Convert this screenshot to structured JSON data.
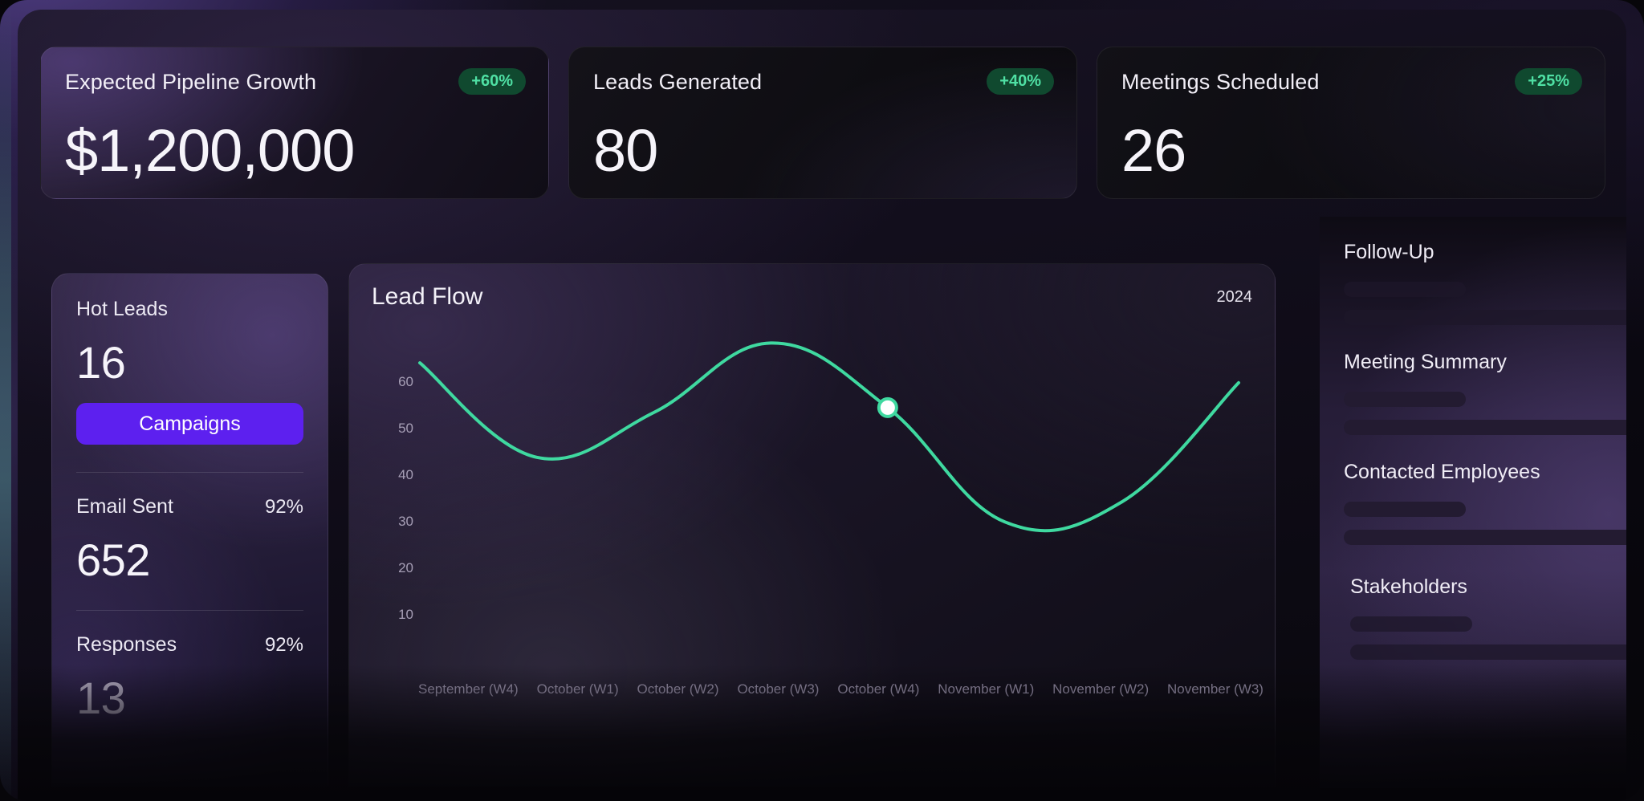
{
  "kpis": [
    {
      "title": "Expected Pipeline Growth",
      "value": "$1,200,000",
      "badge": "+60%"
    },
    {
      "title": "Leads Generated",
      "value": "80",
      "badge": "+40%"
    },
    {
      "title": "Meetings Scheduled",
      "value": "26",
      "badge": "+25%"
    }
  ],
  "left_card": {
    "hot_leads_label": "Hot Leads",
    "hot_leads_value": "16",
    "campaigns_button": "Campaigns",
    "email_sent_label": "Email Sent",
    "email_sent_pct": "92%",
    "email_sent_value": "652",
    "responses_label": "Responses",
    "responses_pct": "92%",
    "responses_value": "13"
  },
  "chart_data": {
    "type": "line",
    "title": "Lead Flow",
    "year_label": "2024",
    "xlabel": "",
    "ylabel": "",
    "grid": false,
    "legend": "none",
    "line_color": "#3fd9a0",
    "ylim": [
      5,
      68
    ],
    "yticks": [
      60,
      50,
      40,
      30,
      20,
      10
    ],
    "categories": [
      "September (W4)",
      "October (W1)",
      "October (W2)",
      "October (W3)",
      "October (W4)",
      "November (W1)",
      "November (W2)",
      "November (W3)"
    ],
    "values": [
      62,
      43,
      52,
      66,
      53,
      30,
      34,
      58
    ],
    "highlight_point": {
      "x_index": 4,
      "value": 53
    }
  },
  "right_panel": {
    "sections": [
      {
        "title": "Follow-Up"
      },
      {
        "title": "Meeting Summary"
      },
      {
        "title": "Contacted Employees"
      },
      {
        "title": "Stakeholders"
      }
    ]
  },
  "colors": {
    "accent_purple": "#5d20ef",
    "accent_green": "#3fd9a0",
    "badge_bg": "#10492f",
    "badge_text": "#4fe0a4"
  }
}
